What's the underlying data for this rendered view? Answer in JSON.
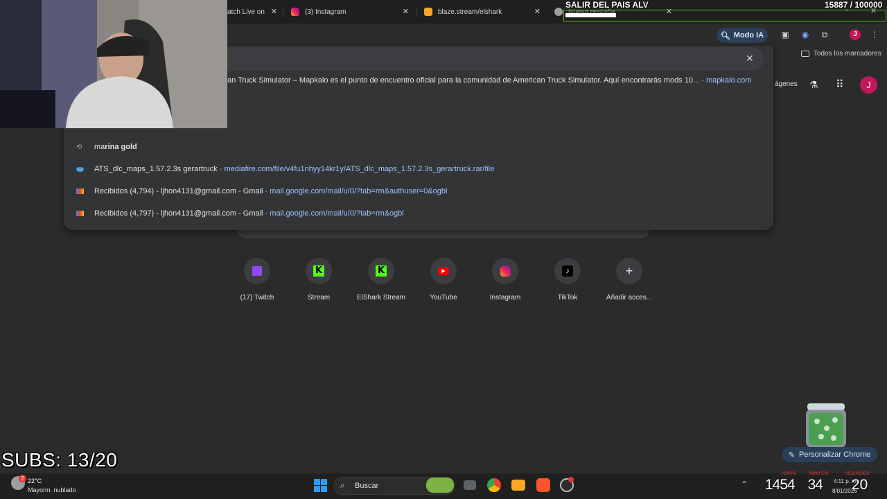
{
  "tabs": [
    {
      "title": "atch Live on",
      "favicon": "twitch-icon"
    },
    {
      "title": "(3) Instagram",
      "favicon": "instagram-icon"
    },
    {
      "title": "blaze.stream/elshark",
      "favicon": "blaze-icon"
    },
    {
      "title": "Nueva pestaña",
      "favicon": "chrome-icon"
    }
  ],
  "toolbar": {
    "modo_ia": "Modo IA",
    "profile_initial": "J"
  },
  "bookmarks": {
    "all_label": "Todos los marcadores"
  },
  "ntp": {
    "images_label": "ágenes",
    "profile_initial": "J"
  },
  "omnibox": {
    "top_suggestion": {
      "text": "an Truck Simulator – Mapkalo es el punto de encuentro oficial para la comunidad de American Truck Simulator. Aquí encontrarás mods 10...",
      "sep": " - ",
      "url": "mapkalo.com"
    },
    "suggestions": [
      {
        "icon": "history-icon",
        "bold": "rina gold",
        "prefix": "ma",
        "text": "",
        "url": ""
      },
      {
        "icon": "mediafire-icon",
        "text": "ATS_dlc_maps_1.57.2.3s gerartruck",
        "sep": " - ",
        "url": "mediafire.com/file/v4fu1nhyy14kr1y/ATS_dlc_maps_1.57.2.3s_gerartruck.rar/file"
      },
      {
        "icon": "gmail-icon",
        "text": "Recibidos (4,794) - ljhon4131@gmail.com - Gmail",
        "sep": " - ",
        "url": "mail.google.com/mail/u/0/?tab=rm&authuser=0&ogbl"
      },
      {
        "icon": "gmail-icon",
        "text": "Recibidos (4,797) - ljhon4131@gmail.com - Gmail",
        "sep": " - ",
        "url": "mail.google.com/mail/u/0/?tab=rm&ogbl"
      }
    ]
  },
  "shortcuts": [
    {
      "label": "(17) Twitch",
      "icon": "twitch-icon"
    },
    {
      "label": "Stream",
      "icon": "kick-icon"
    },
    {
      "label": "ElShark Stream",
      "icon": "kick-icon"
    },
    {
      "label": "YouTube",
      "icon": "youtube-icon"
    },
    {
      "label": "Instagram",
      "icon": "instagram-icon"
    },
    {
      "label": "TikTok",
      "icon": "tiktok-icon"
    },
    {
      "label": "Añadir acces...",
      "icon": "plus-icon"
    }
  ],
  "overlay": {
    "goal_title": "SALIR DEL PAIS ALV",
    "goal_count": "15887  / 100000",
    "goal_progress": 0.159,
    "subs": "SUBS: 13/20",
    "timer_hours": "1454",
    "timer_minutes": "34",
    "timer_seconds": "20",
    "labels": [
      "HORAS",
      "MINUTOS",
      "SEGUNDOS"
    ]
  },
  "customize_chrome": "Personalizar Chrome",
  "taskbar": {
    "weather_temp": "22°C",
    "weather_desc": "Mayorm. nublado",
    "weather_badge": "2",
    "search_label": "Buscar",
    "clock_time": "4:11 p. m.",
    "clock_date": "8/01/2026"
  },
  "colors": {
    "accent": "#2c3f58",
    "goal_bar": "#56c02b",
    "kick": "#53fc18"
  }
}
